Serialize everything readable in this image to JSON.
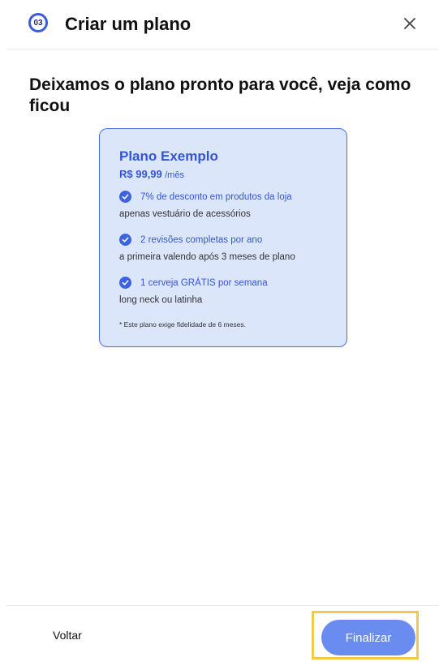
{
  "header": {
    "step_number": "03",
    "title": "Criar um plano",
    "close_icon": "close-icon"
  },
  "headline": "Deixamos o plano pronto para você, veja como ficou",
  "plan": {
    "name": "Plano Exemplo",
    "price_amount": "R$ 99,99",
    "price_period": "/mês",
    "features": [
      {
        "title": "7% de desconto em produtos da loja",
        "description": "apenas vestuário de acessórios"
      },
      {
        "title": "2 revisões completas por ano",
        "description": "a primeira valendo após 3 meses de plano"
      },
      {
        "title": "1 cerveja GRÁTIS por semana",
        "description": "long neck ou latinha"
      }
    ],
    "note": "* Este plano exige fidelidade de 6 meses.",
    "check_icon": "check-circle-icon"
  },
  "footer": {
    "back_label": "Voltar",
    "finish_label": "Finalizar"
  },
  "colors": {
    "accent": "#3355d6",
    "card_background": "#dbe6fb",
    "primary_button": "#6a8bf0",
    "highlight": "#f2c94c"
  }
}
